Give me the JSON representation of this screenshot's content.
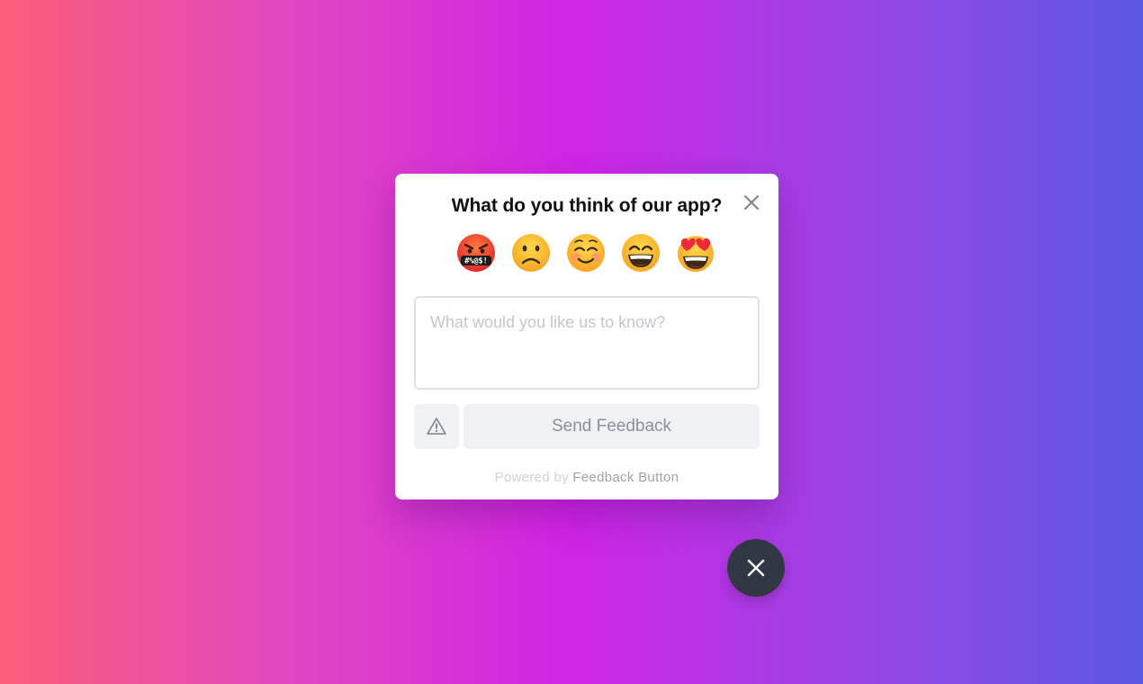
{
  "widget": {
    "title": "What do you think of our app?",
    "close_icon": "close-icon",
    "ratings": [
      {
        "name": "cursing-face",
        "icon": "angry-face-with-symbols-icon"
      },
      {
        "name": "frowning-face",
        "icon": "frowning-face-icon"
      },
      {
        "name": "smiling-face",
        "icon": "smiling-face-icon"
      },
      {
        "name": "grinning-face",
        "icon": "grinning-face-icon"
      },
      {
        "name": "heart-eyes-face",
        "icon": "heart-eyes-face-icon"
      }
    ],
    "feedback_placeholder": "What would you like us to know?",
    "feedback_value": "",
    "report_icon": "warning-triangle-icon",
    "send_label": "Send Feedback",
    "footer_prefix": "Powered by ",
    "footer_brand": "Feedback Button"
  },
  "fab": {
    "icon": "close-icon"
  },
  "colors": {
    "background_gradient": [
      "#fb5e78",
      "#d024e6",
      "#5d57e6"
    ],
    "fab": "#323843",
    "button_bg": "#eff1f4"
  }
}
